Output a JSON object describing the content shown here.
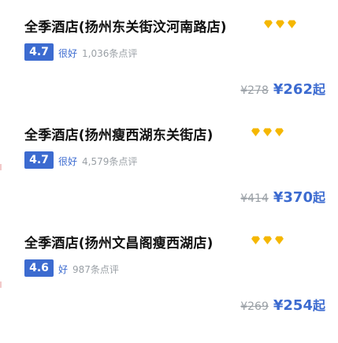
{
  "colors": {
    "accent": "#3c6bd0",
    "diamond": "#f5b700",
    "muted": "#9aa0a6"
  },
  "hotels": [
    {
      "name": "全季酒店(扬州东关街汶河南路店)",
      "diamond_count": 3,
      "score": "4.7",
      "rating_label": "很好",
      "reviews": "1,036条点评",
      "old_price": "¥278",
      "price": "¥262",
      "suffix": "起"
    },
    {
      "name": "全季酒店(扬州瘦西湖东关街店)",
      "diamond_count": 3,
      "score": "4.7",
      "rating_label": "很好",
      "reviews": "4,579条点评",
      "old_price": "¥414",
      "price": "¥370",
      "suffix": "起"
    },
    {
      "name": "全季酒店(扬州文昌阁瘦西湖店)",
      "diamond_count": 3,
      "score": "4.6",
      "rating_label": "好",
      "reviews": "987条点评",
      "old_price": "¥269",
      "price": "¥254",
      "suffix": "起"
    }
  ]
}
